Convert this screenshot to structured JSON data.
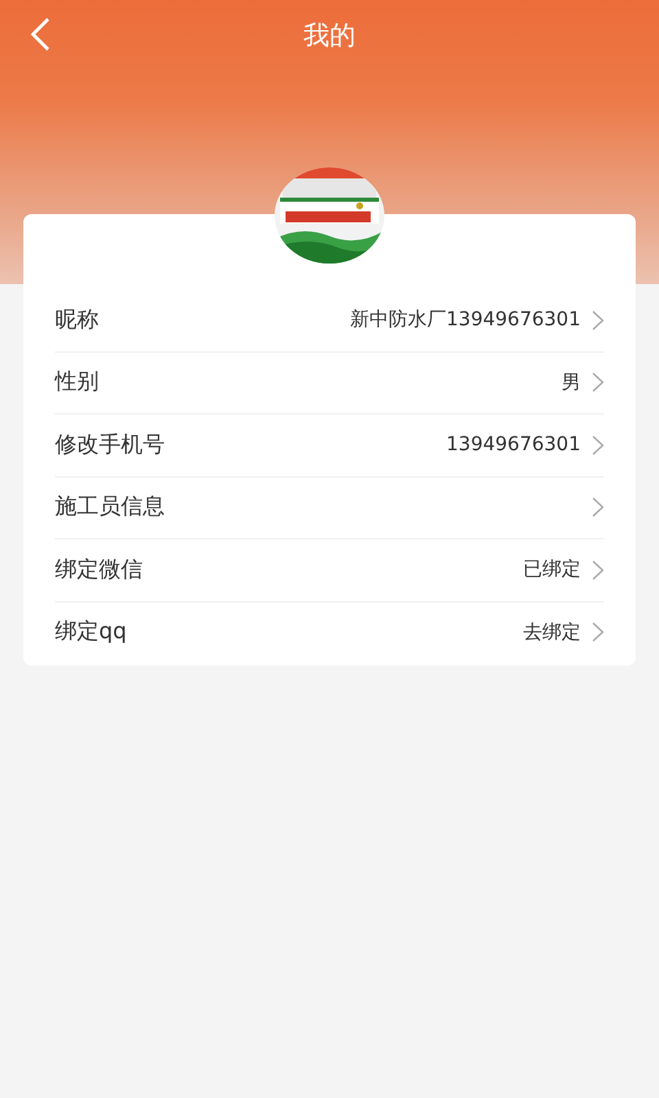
{
  "header": {
    "title": "我的"
  },
  "rows": [
    {
      "label": "昵称",
      "value": "新中防水厂13949676301"
    },
    {
      "label": "性别",
      "value": "男"
    },
    {
      "label": "修改手机号",
      "value": "13949676301"
    },
    {
      "label": "施工员信息"
    },
    {
      "label": "绑定微信",
      "value": "已绑定"
    },
    {
      "label": "绑定qq",
      "value": "去绑定"
    }
  ]
}
